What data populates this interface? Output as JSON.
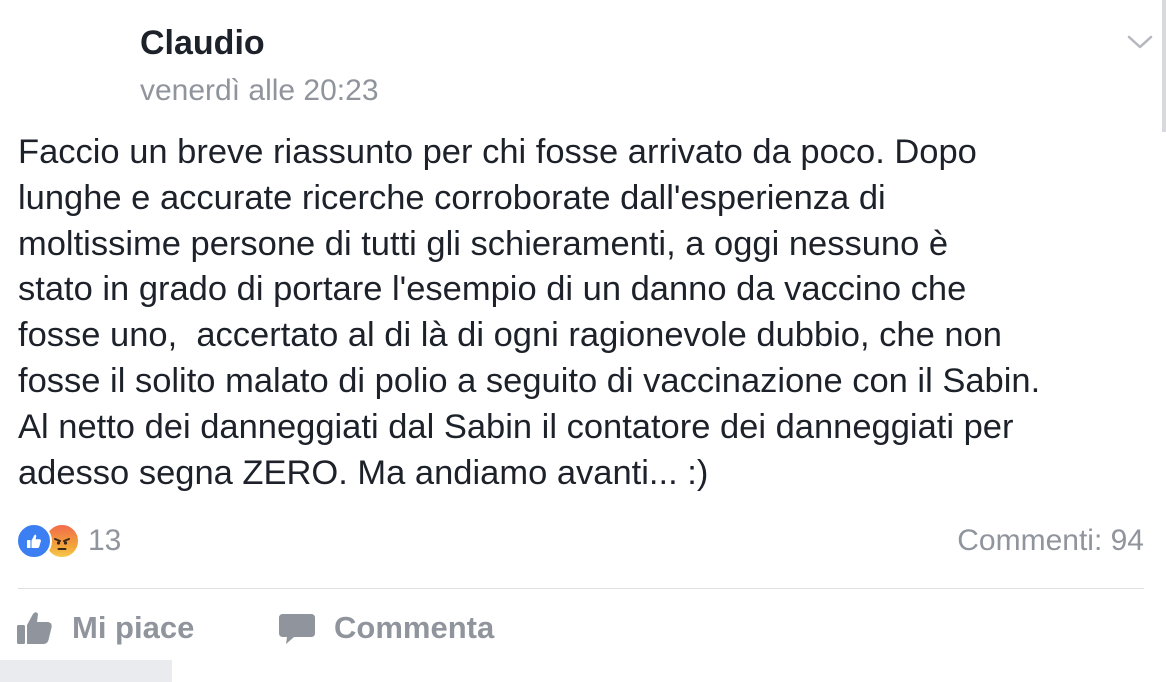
{
  "post": {
    "author": "Claudio",
    "timestamp": "venerdì alle 20:23",
    "text_lines": [
      "Faccio un breve riassunto per chi fosse arrivato da poco. Dopo",
      "lunghe e accurate ricerche corroborate dall'esperienza di",
      "moltissime persone di tutti gli schieramenti, a oggi nessuno è",
      "stato in grado di portare l'esempio di un danno da vaccino che",
      "fosse uno,  accertato al di là di ogni ragionevole dubbio, che non",
      "fosse il solito malato di polio a seguito di vaccinazione con il Sabin.",
      "Al netto dei danneggiati dal Sabin il contatore dei danneggiati per",
      "adesso segna ZERO. Ma andiamo avanti... :)"
    ]
  },
  "reactions": {
    "icons": [
      "like-reaction-icon",
      "angry-reaction-icon"
    ],
    "count": "13"
  },
  "comments": {
    "label": "Commenti: 94"
  },
  "actions": {
    "like_label": "Mi piace",
    "like_icon": "thumbs-up-icon",
    "comment_label": "Commenta",
    "comment_icon": "speech-bubble-icon"
  },
  "header": {
    "options_icon": "chevron-down-icon"
  },
  "colors": {
    "text_primary": "#1d2129",
    "text_secondary": "#90949c",
    "like_blue": "#3b7ff2",
    "divider": "#dddfe2"
  }
}
